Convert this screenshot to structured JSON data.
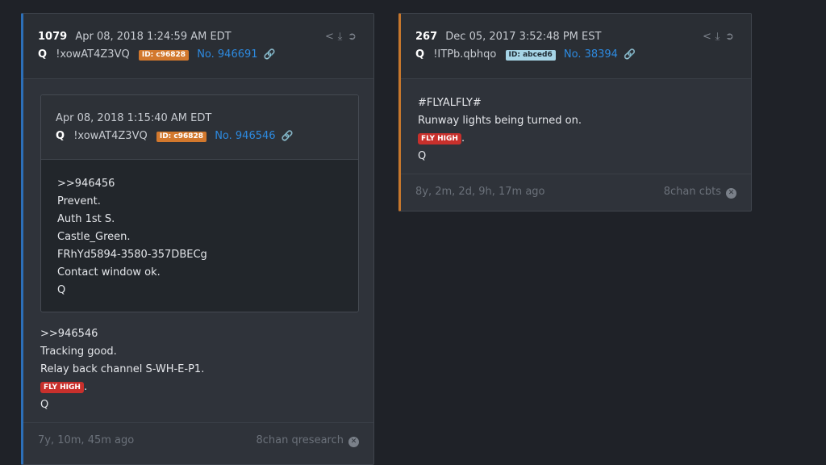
{
  "posts": [
    {
      "number": "1079",
      "date": "Apr 08, 2018 1:24:59 AM EDT",
      "author": "Q",
      "tripcode": "!xowAT4Z3VQ",
      "id_badge": "ID: c96828",
      "post_no": "No. 946691",
      "quote": {
        "date": "Apr 08, 2018 1:15:40 AM EDT",
        "author": "Q",
        "tripcode": "!xowAT4Z3VQ",
        "id_badge": "ID: c96828",
        "post_no": "No. 946546",
        "lines": [
          "&gt;&gt;946456",
          "Prevent.",
          "Auth 1st S.",
          "Castle_Green.",
          "FRhYd5894-3580-357DBECg",
          "Contact window ok.",
          "Q"
        ]
      },
      "lines": [
        ">>946546",
        "Tracking good.",
        "Relay back channel S-WH-E-P1."
      ],
      "fly_label": "FLY HIGH",
      "fly_suffix": ".",
      "signature": "Q",
      "age": "7y, 10m, 45m ago",
      "source": "8chan qresearch"
    },
    {
      "number": "267",
      "date": "Dec 05, 2017 3:52:48 PM EST",
      "author": "Q",
      "tripcode": "!ITPb.qbhqo",
      "id_badge": "ID: abced6",
      "post_no": "No. 38394",
      "lines": [
        "#FLYALFLY#",
        "Runway lights being turned on."
      ],
      "fly_label": "FLY HIGH",
      "fly_suffix": ".",
      "signature": "Q",
      "age": "8y, 2m, 2d, 9h, 17m ago",
      "source": "8chan cbts"
    }
  ],
  "icons": {
    "share": "share-icon",
    "download": "download-icon",
    "open": "arrow-circle-right-icon",
    "link": "link-icon",
    "close": "close-circle-icon"
  },
  "colors": {
    "left_accent": "#2c6fb8",
    "right_accent": "#c6772d",
    "link": "#2d8ae0",
    "fly_high": "#c8302c"
  }
}
